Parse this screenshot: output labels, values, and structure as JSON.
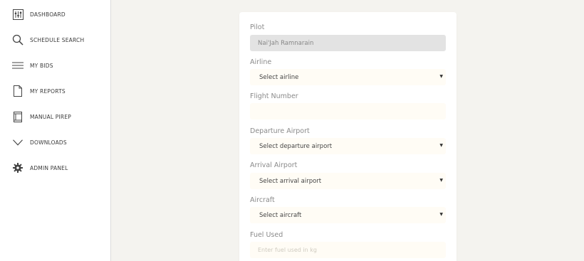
{
  "sidebar": {
    "items": [
      {
        "label": "DASHBOARD",
        "icon": "sliders-icon"
      },
      {
        "label": "SCHEDULE SEARCH",
        "icon": "search-icon"
      },
      {
        "label": "MY BIDS",
        "icon": "list-icon"
      },
      {
        "label": "MY REPORTS",
        "icon": "document-icon"
      },
      {
        "label": "MANUAL PIREP",
        "icon": "form-icon"
      },
      {
        "label": "DOWNLOADS",
        "icon": "chevron-down-icon"
      },
      {
        "label": "ADMIN PANEL",
        "icon": "gear-icon"
      }
    ]
  },
  "form": {
    "pilot": {
      "label": "Pilot",
      "value": "Nai'Jah Ramnarain"
    },
    "airline": {
      "label": "Airline",
      "value": "Select airline"
    },
    "flight_number": {
      "label": "Flight Number",
      "value": ""
    },
    "departure": {
      "label": "Departure Airport",
      "value": "Select departure airport"
    },
    "arrival": {
      "label": "Arrival Airport",
      "value": "Select arrival airport"
    },
    "aircraft": {
      "label": "Aircraft",
      "value": "Select aircraft"
    },
    "fuel": {
      "label": "Fuel Used",
      "placeholder": "Enter fuel used in kg"
    },
    "caret": "▼"
  },
  "colors": {
    "page_bg": "#f4f3ef",
    "input_bg": "#fffcf5",
    "disabled_bg": "#e3e3e3"
  }
}
